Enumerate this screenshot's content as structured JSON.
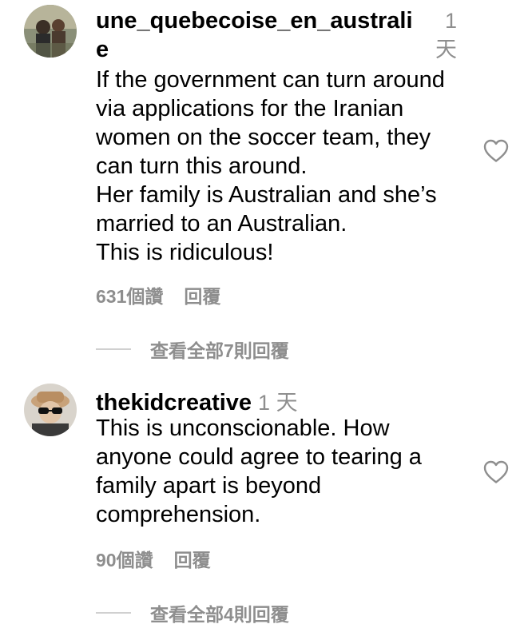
{
  "comments": [
    {
      "username": "une_quebecoise_en_australie",
      "username_line1": "une_quebecoise_en_australi",
      "username_line2": "e",
      "time_line1": "1",
      "time_line2": "天",
      "text": "If the government can turn around\nvia applications for the Iranian\nwomen on the soccer team, they\ncan turn this around.\nHer family is Australian and she’s\nmarried to an Australian.\nThis is ridiculous!",
      "likes": "631個讚",
      "reply": "回覆",
      "view_replies": "查看全部7則回覆",
      "avatar_icon": "profile-photo"
    },
    {
      "username": "thekidcreative",
      "time": "1 天",
      "text": "This is unconscionable. How\nanyone could agree to tearing a\nfamily apart is beyond\ncomprehension.",
      "likes": "90個讚",
      "reply": "回覆",
      "view_replies": "查看全部4則回覆",
      "avatar_icon": "profile-photo"
    }
  ],
  "colors": {
    "text": "#000000",
    "secondary": "#8e8e8e",
    "divider": "#d0d0d0"
  },
  "icons": {
    "like": "heart-outline-icon"
  }
}
